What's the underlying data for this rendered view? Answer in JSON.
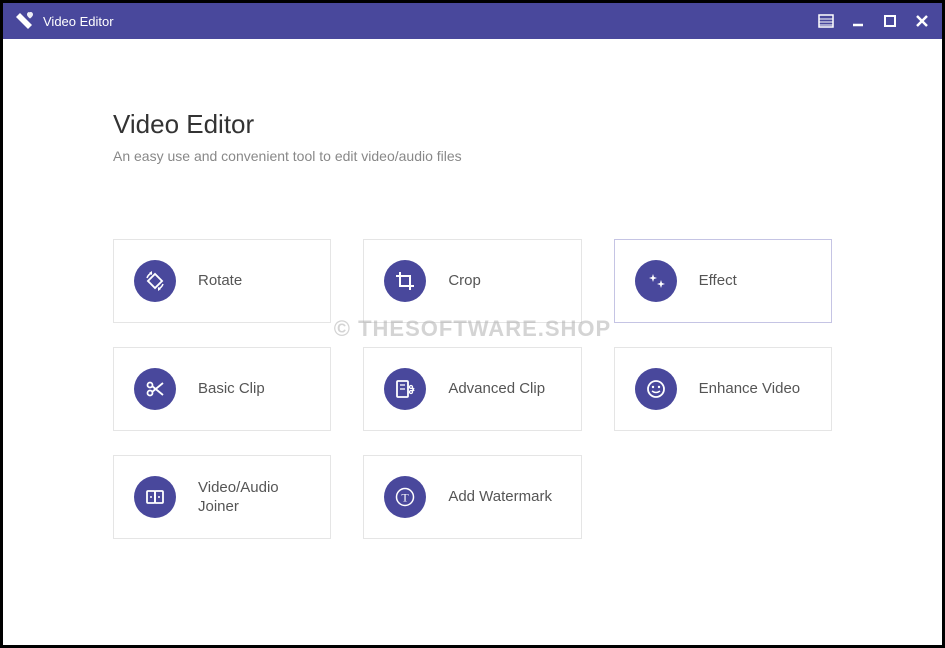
{
  "titlebar": {
    "title": "Video Editor",
    "icons": {
      "app": "tag-heart-icon",
      "menu": "menu-icon",
      "minimize": "minimize-icon",
      "maximize": "maximize-icon",
      "close": "close-icon"
    }
  },
  "header": {
    "title": "Video Editor",
    "subtitle": "An easy use and convenient tool to edit video/audio files"
  },
  "tools": [
    {
      "id": "rotate",
      "label": "Rotate",
      "icon": "rotate-icon",
      "selected": false
    },
    {
      "id": "crop",
      "label": "Crop",
      "icon": "crop-icon",
      "selected": false
    },
    {
      "id": "effect",
      "label": "Effect",
      "icon": "effect-icon",
      "selected": true
    },
    {
      "id": "basic-clip",
      "label": "Basic Clip",
      "icon": "scissors-icon",
      "selected": false
    },
    {
      "id": "advanced-clip",
      "label": "Advanced Clip",
      "icon": "advanced-clip-icon",
      "selected": false
    },
    {
      "id": "enhance-video",
      "label": "Enhance Video",
      "icon": "enhance-icon",
      "selected": false
    },
    {
      "id": "joiner",
      "label": "Video/Audio Joiner",
      "icon": "joiner-icon",
      "selected": false
    },
    {
      "id": "watermark",
      "label": "Add Watermark",
      "icon": "text-icon",
      "selected": false
    }
  ],
  "watermark_text": "© THESOFTWARE.SHOP",
  "colors": {
    "accent": "#49489c",
    "border": "#e5e5e5",
    "text": "#555",
    "subtext": "#888"
  }
}
